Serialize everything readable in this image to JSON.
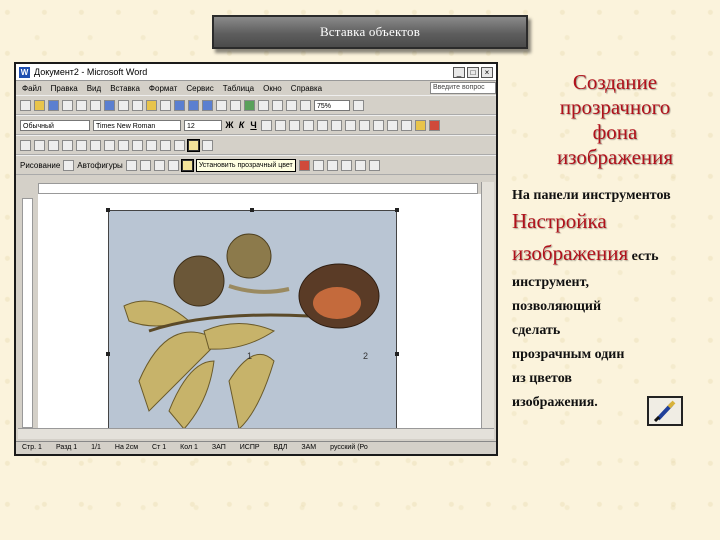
{
  "banner": {
    "title": "Вставка объектов"
  },
  "word": {
    "title": "Документ2 - Microsoft Word",
    "menu": [
      "Файл",
      "Правка",
      "Вид",
      "Вставка",
      "Формат",
      "Сервис",
      "Таблица",
      "Окно",
      "Справка"
    ],
    "question_placeholder": "Введите вопрос",
    "style": "Обычный",
    "font": "Times New Roman",
    "size": "12",
    "zoom": "75%",
    "draw_label": "Рисование",
    "autoshapes": "Автофигуры",
    "tooltip": "Установить прозрачный цвет",
    "image_labels": [
      "1",
      "2"
    ],
    "status": [
      "Стр. 1",
      "Разд 1",
      "1/1",
      "На 2см",
      "Ст 1",
      "Кол 1",
      "ЗАП",
      "ИСПР",
      "ВДЛ",
      "ЗАМ",
      "русский (Ро"
    ]
  },
  "slide": {
    "heading_lines": [
      "Создание",
      "прозрачного",
      "фона",
      "изображения"
    ],
    "intro": "На панели инструментов",
    "toolbar_name": "Настройка изображения",
    "rest_first": " есть",
    "rest_lines": [
      "инструмент,",
      "позволяющий",
      "сделать",
      "прозрачным один",
      "из цветов",
      "изображения."
    ]
  },
  "icons": {
    "wand": "set-transparent-color-icon"
  }
}
